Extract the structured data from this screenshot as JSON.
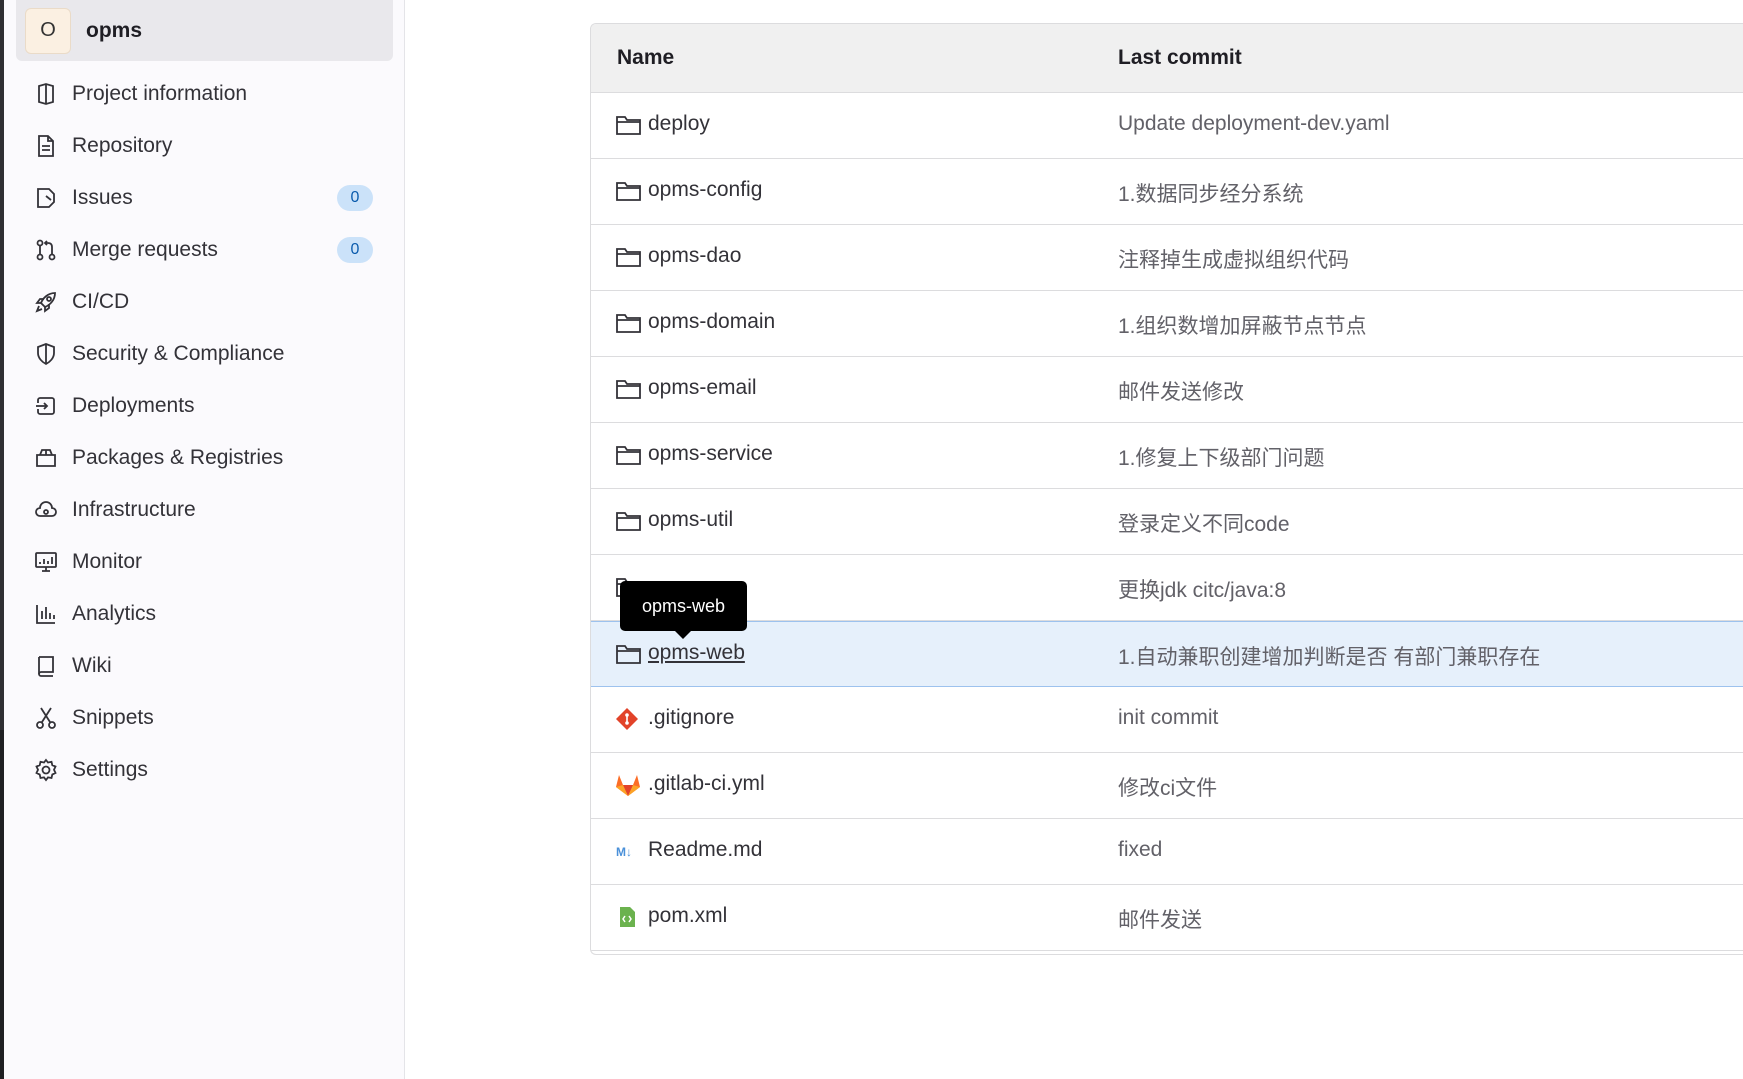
{
  "project": {
    "avatar_letter": "O",
    "name": "opms"
  },
  "sidebar": {
    "items": [
      {
        "label": "Project information",
        "icon": "project-icon"
      },
      {
        "label": "Repository",
        "icon": "document-icon"
      },
      {
        "label": "Issues",
        "icon": "issues-icon",
        "count": "0"
      },
      {
        "label": "Merge requests",
        "icon": "merge-request-icon",
        "count": "0"
      },
      {
        "label": "CI/CD",
        "icon": "rocket-icon"
      },
      {
        "label": "Security & Compliance",
        "icon": "shield-icon"
      },
      {
        "label": "Deployments",
        "icon": "deployments-icon"
      },
      {
        "label": "Packages & Registries",
        "icon": "package-icon"
      },
      {
        "label": "Infrastructure",
        "icon": "cloud-gear-icon"
      },
      {
        "label": "Monitor",
        "icon": "monitor-icon"
      },
      {
        "label": "Analytics",
        "icon": "chart-icon"
      },
      {
        "label": "Wiki",
        "icon": "book-icon"
      },
      {
        "label": "Snippets",
        "icon": "scissors-icon"
      },
      {
        "label": "Settings",
        "icon": "gear-icon"
      }
    ]
  },
  "table": {
    "headers": {
      "name": "Name",
      "last_commit": "Last commit"
    },
    "rows": [
      {
        "name": "deploy",
        "type": "folder",
        "commit": "Update deployment-dev.yaml"
      },
      {
        "name": "opms-config",
        "type": "folder",
        "commit": "1.数据同步经分系统"
      },
      {
        "name": "opms-dao",
        "type": "folder",
        "commit": "注释掉生成虚拟组织代码"
      },
      {
        "name": "opms-domain",
        "type": "folder",
        "commit": "1.组织数增加屏蔽节点节点"
      },
      {
        "name": "opms-email",
        "type": "folder",
        "commit": "邮件发送修改"
      },
      {
        "name": "opms-service",
        "type": "folder",
        "commit": "1.修复上下级部门问题"
      },
      {
        "name": "opms-util",
        "type": "folder",
        "commit": "登录定义不同code"
      },
      {
        "name": "",
        "type": "folder",
        "commit": "更换jdk citc/java:8"
      },
      {
        "name": "opms-web",
        "type": "folder",
        "commit": "1.自动兼职创建增加判断是否 有部门兼职存在"
      },
      {
        "name": ".gitignore",
        "type": "git",
        "commit": "init commit"
      },
      {
        "name": ".gitlab-ci.yml",
        "type": "gitlab",
        "commit": "修改ci文件"
      },
      {
        "name": "Readme.md",
        "type": "markdown",
        "commit": "fixed"
      },
      {
        "name": "pom.xml",
        "type": "xml",
        "commit": "邮件发送"
      }
    ]
  },
  "tooltip": {
    "text": "opms-web"
  },
  "colors": {
    "accent": "#1f75cb",
    "highlight_row": "#e6f0fb",
    "badge_bg": "#cbe2f9"
  }
}
